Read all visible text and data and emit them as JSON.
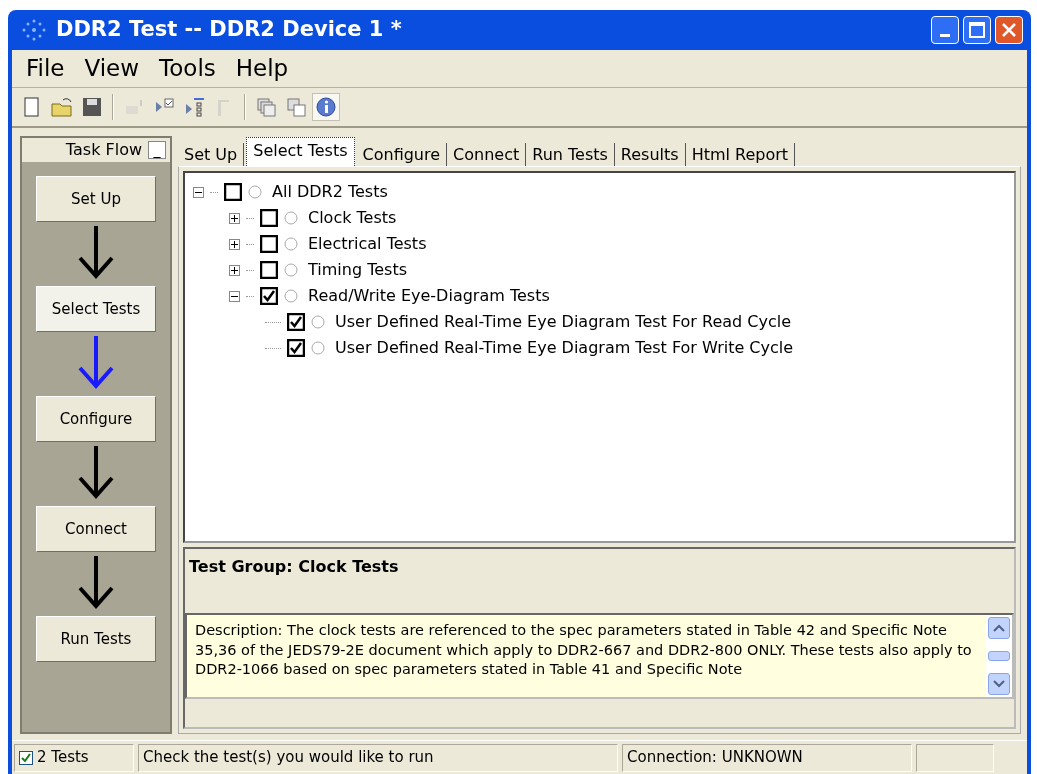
{
  "window": {
    "title": "DDR2 Test -- DDR2 Device 1 *"
  },
  "menu": [
    "File",
    "View",
    "Tools",
    "Help"
  ],
  "toolbar": [
    [
      {
        "disabled": false,
        "pressed": false
      },
      {
        "disabled": false,
        "pressed": false
      },
      {
        "disabled": false,
        "pressed": false
      }
    ],
    [
      {
        "disabled": true,
        "pressed": false
      },
      {
        "disabled": false,
        "pressed": false
      },
      {
        "disabled": false,
        "pressed": false
      },
      {
        "disabled": true,
        "pressed": false
      }
    ],
    [
      {
        "disabled": false,
        "pressed": false
      },
      {
        "disabled": false,
        "pressed": false
      },
      {
        "disabled": false,
        "pressed": true
      }
    ]
  ],
  "task_flow": {
    "title": "Task Flow",
    "minimize": "_",
    "steps": [
      {
        "label": "Set Up",
        "selected": false
      },
      {
        "label": "Select Tests",
        "selected": true
      },
      {
        "label": "Configure",
        "selected": false
      },
      {
        "label": "Connect",
        "selected": false
      },
      {
        "label": "Run Tests",
        "selected": false
      }
    ]
  },
  "tabs": [
    {
      "label": "Set Up",
      "selected": false
    },
    {
      "label": "Select Tests",
      "selected": true
    },
    {
      "label": "Configure",
      "selected": false
    },
    {
      "label": "Connect",
      "selected": false
    },
    {
      "label": "Run Tests",
      "selected": false
    },
    {
      "label": "Results",
      "selected": false
    },
    {
      "label": "Html Report",
      "selected": false
    }
  ],
  "tree": [
    {
      "label": "All DDR2 Tests",
      "checked": false,
      "expanded": true,
      "children": [
        {
          "label": "Clock Tests",
          "checked": false,
          "expanded": false
        },
        {
          "label": "Electrical Tests",
          "checked": false,
          "expanded": false
        },
        {
          "label": "Timing Tests",
          "checked": false,
          "expanded": false
        },
        {
          "label": "Read/Write Eye-Diagram Tests",
          "checked": true,
          "expanded": true,
          "children": [
            {
              "label": "User Defined Real-Time Eye Diagram Test For Read Cycle",
              "checked": true
            },
            {
              "label": "User Defined Real-Time Eye Diagram Test For Write Cycle",
              "checked": true
            }
          ]
        }
      ]
    }
  ],
  "info": {
    "heading": "Test Group: Clock Tests",
    "description": "Description: The clock tests are referenced to the spec parameters stated in Table 42 and Specific Note 35,36 of the JEDS79-2E document which apply to DDR2-667 and DDR2-800 ONLY. These tests also apply to DDR2-1066 based on spec parameters stated in Table 41 and Specific Note"
  },
  "status_bar": {
    "tests_checked": true,
    "tests": "2 Tests",
    "message": "Check the test(s) you would like to run",
    "connection": "Connection: UNKNOWN"
  }
}
